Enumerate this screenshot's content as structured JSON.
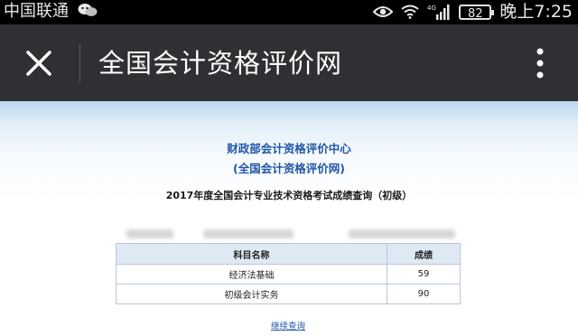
{
  "status_bar": {
    "carrier": "中国联通",
    "wechat_icon": "wechat-icon",
    "battery_level": "82",
    "time": "晚上7:25"
  },
  "title_bar": {
    "title": "全国会计资格评价网",
    "close_icon": "close-icon",
    "menu_icon": "more-vertical-icon"
  },
  "page": {
    "center_name": "财政部会计资格评价中心",
    "site_name": "(全国会计资格评价网)",
    "query_title": "2017年度全国会计专业技术资格考试成绩查询（初级）",
    "table": {
      "headers": [
        "科目名称",
        "成绩"
      ],
      "rows": [
        {
          "subject": "经济法基础",
          "score": "59"
        },
        {
          "subject": "初级会计实务",
          "score": "90"
        }
      ]
    },
    "continue_label": "继续查询"
  },
  "colors": {
    "status_bar_bg": "#000000",
    "title_bar_bg": "#2e3033",
    "link_blue": "#2156a8"
  }
}
